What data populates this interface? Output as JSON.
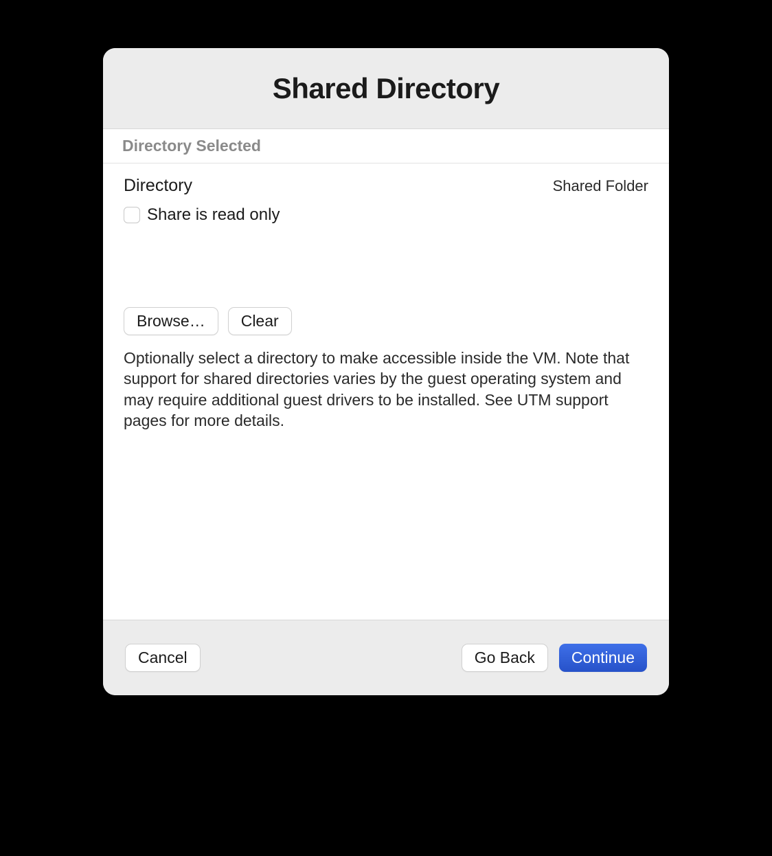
{
  "title": "Shared Directory",
  "section_header": "Directory Selected",
  "directory": {
    "label": "Directory",
    "value": "Shared Folder"
  },
  "readonly": {
    "label": "Share is read only",
    "checked": false
  },
  "buttons": {
    "browse": "Browse…",
    "clear": "Clear"
  },
  "description": "Optionally select a directory to make accessible inside the VM. Note that support for shared directories varies by the guest operating system and may require additional guest drivers to be installed. See UTM support pages for more details.",
  "footer": {
    "cancel": "Cancel",
    "go_back": "Go Back",
    "continue": "Continue"
  }
}
